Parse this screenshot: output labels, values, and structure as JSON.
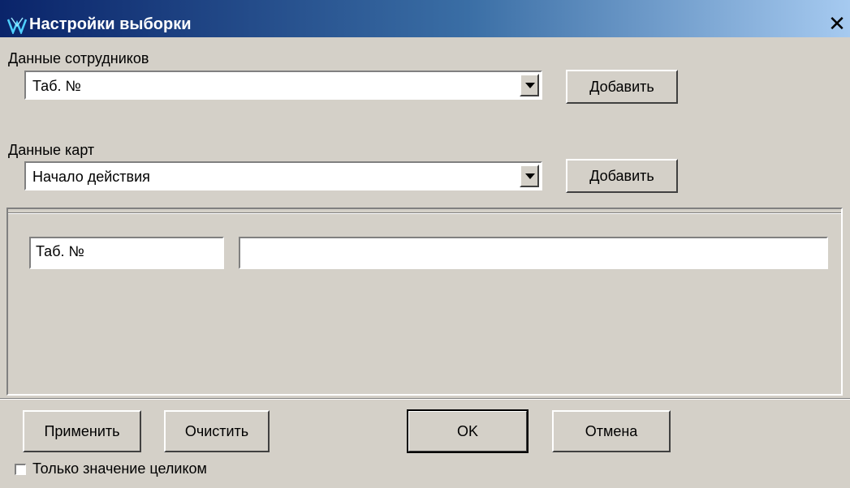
{
  "window": {
    "title": "Настройки выборки",
    "close_glyph": "✕"
  },
  "employee_data": {
    "label": "Данные сотрудников",
    "selected": "Таб. №",
    "add_label": "Добавить"
  },
  "card_data": {
    "label": "Данные карт",
    "selected": "Начало действия",
    "add_label": "Добавить"
  },
  "filter": {
    "field_name": "Таб. №",
    "field_value": ""
  },
  "actions": {
    "apply_label": "Применить",
    "clear_label": "Очистить",
    "ok_label": "OK",
    "cancel_label": "Отмена"
  },
  "options": {
    "whole_value_label": "Только значение целиком",
    "whole_value_checked": false
  },
  "colors": {
    "title_start": "#0a246a",
    "title_end": "#a6caf0",
    "face": "#d4d0c8"
  }
}
